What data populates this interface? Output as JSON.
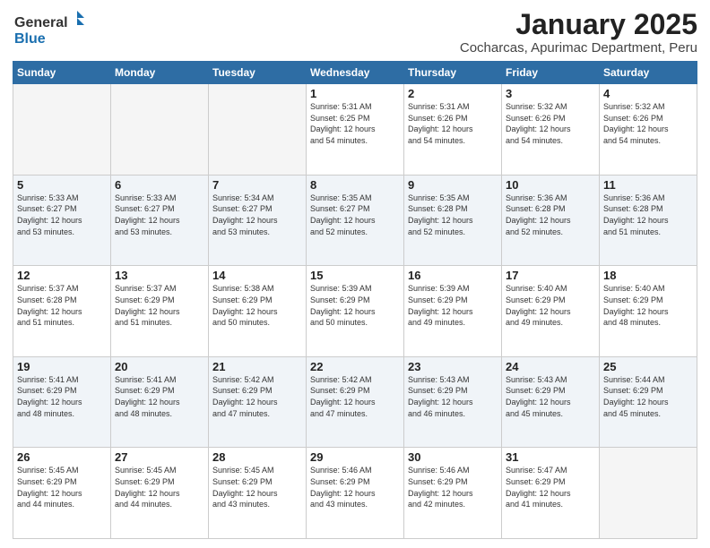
{
  "header": {
    "logo_general": "General",
    "logo_blue": "Blue",
    "title": "January 2025",
    "subtitle": "Cocharcas, Apurimac Department, Peru"
  },
  "weekdays": [
    "Sunday",
    "Monday",
    "Tuesday",
    "Wednesday",
    "Thursday",
    "Friday",
    "Saturday"
  ],
  "weeks": [
    [
      {
        "num": "",
        "info": ""
      },
      {
        "num": "",
        "info": ""
      },
      {
        "num": "",
        "info": ""
      },
      {
        "num": "1",
        "info": "Sunrise: 5:31 AM\nSunset: 6:25 PM\nDaylight: 12 hours\nand 54 minutes."
      },
      {
        "num": "2",
        "info": "Sunrise: 5:31 AM\nSunset: 6:26 PM\nDaylight: 12 hours\nand 54 minutes."
      },
      {
        "num": "3",
        "info": "Sunrise: 5:32 AM\nSunset: 6:26 PM\nDaylight: 12 hours\nand 54 minutes."
      },
      {
        "num": "4",
        "info": "Sunrise: 5:32 AM\nSunset: 6:26 PM\nDaylight: 12 hours\nand 54 minutes."
      }
    ],
    [
      {
        "num": "5",
        "info": "Sunrise: 5:33 AM\nSunset: 6:27 PM\nDaylight: 12 hours\nand 53 minutes."
      },
      {
        "num": "6",
        "info": "Sunrise: 5:33 AM\nSunset: 6:27 PM\nDaylight: 12 hours\nand 53 minutes."
      },
      {
        "num": "7",
        "info": "Sunrise: 5:34 AM\nSunset: 6:27 PM\nDaylight: 12 hours\nand 53 minutes."
      },
      {
        "num": "8",
        "info": "Sunrise: 5:35 AM\nSunset: 6:27 PM\nDaylight: 12 hours\nand 52 minutes."
      },
      {
        "num": "9",
        "info": "Sunrise: 5:35 AM\nSunset: 6:28 PM\nDaylight: 12 hours\nand 52 minutes."
      },
      {
        "num": "10",
        "info": "Sunrise: 5:36 AM\nSunset: 6:28 PM\nDaylight: 12 hours\nand 52 minutes."
      },
      {
        "num": "11",
        "info": "Sunrise: 5:36 AM\nSunset: 6:28 PM\nDaylight: 12 hours\nand 51 minutes."
      }
    ],
    [
      {
        "num": "12",
        "info": "Sunrise: 5:37 AM\nSunset: 6:28 PM\nDaylight: 12 hours\nand 51 minutes."
      },
      {
        "num": "13",
        "info": "Sunrise: 5:37 AM\nSunset: 6:29 PM\nDaylight: 12 hours\nand 51 minutes."
      },
      {
        "num": "14",
        "info": "Sunrise: 5:38 AM\nSunset: 6:29 PM\nDaylight: 12 hours\nand 50 minutes."
      },
      {
        "num": "15",
        "info": "Sunrise: 5:39 AM\nSunset: 6:29 PM\nDaylight: 12 hours\nand 50 minutes."
      },
      {
        "num": "16",
        "info": "Sunrise: 5:39 AM\nSunset: 6:29 PM\nDaylight: 12 hours\nand 49 minutes."
      },
      {
        "num": "17",
        "info": "Sunrise: 5:40 AM\nSunset: 6:29 PM\nDaylight: 12 hours\nand 49 minutes."
      },
      {
        "num": "18",
        "info": "Sunrise: 5:40 AM\nSunset: 6:29 PM\nDaylight: 12 hours\nand 48 minutes."
      }
    ],
    [
      {
        "num": "19",
        "info": "Sunrise: 5:41 AM\nSunset: 6:29 PM\nDaylight: 12 hours\nand 48 minutes."
      },
      {
        "num": "20",
        "info": "Sunrise: 5:41 AM\nSunset: 6:29 PM\nDaylight: 12 hours\nand 48 minutes."
      },
      {
        "num": "21",
        "info": "Sunrise: 5:42 AM\nSunset: 6:29 PM\nDaylight: 12 hours\nand 47 minutes."
      },
      {
        "num": "22",
        "info": "Sunrise: 5:42 AM\nSunset: 6:29 PM\nDaylight: 12 hours\nand 47 minutes."
      },
      {
        "num": "23",
        "info": "Sunrise: 5:43 AM\nSunset: 6:29 PM\nDaylight: 12 hours\nand 46 minutes."
      },
      {
        "num": "24",
        "info": "Sunrise: 5:43 AM\nSunset: 6:29 PM\nDaylight: 12 hours\nand 45 minutes."
      },
      {
        "num": "25",
        "info": "Sunrise: 5:44 AM\nSunset: 6:29 PM\nDaylight: 12 hours\nand 45 minutes."
      }
    ],
    [
      {
        "num": "26",
        "info": "Sunrise: 5:45 AM\nSunset: 6:29 PM\nDaylight: 12 hours\nand 44 minutes."
      },
      {
        "num": "27",
        "info": "Sunrise: 5:45 AM\nSunset: 6:29 PM\nDaylight: 12 hours\nand 44 minutes."
      },
      {
        "num": "28",
        "info": "Sunrise: 5:45 AM\nSunset: 6:29 PM\nDaylight: 12 hours\nand 43 minutes."
      },
      {
        "num": "29",
        "info": "Sunrise: 5:46 AM\nSunset: 6:29 PM\nDaylight: 12 hours\nand 43 minutes."
      },
      {
        "num": "30",
        "info": "Sunrise: 5:46 AM\nSunset: 6:29 PM\nDaylight: 12 hours\nand 42 minutes."
      },
      {
        "num": "31",
        "info": "Sunrise: 5:47 AM\nSunset: 6:29 PM\nDaylight: 12 hours\nand 41 minutes."
      },
      {
        "num": "",
        "info": ""
      }
    ]
  ],
  "colors": {
    "header_bg": "#2e6da4",
    "row_shade": "#f0f4f8",
    "empty_shade": "#f5f5f5"
  }
}
